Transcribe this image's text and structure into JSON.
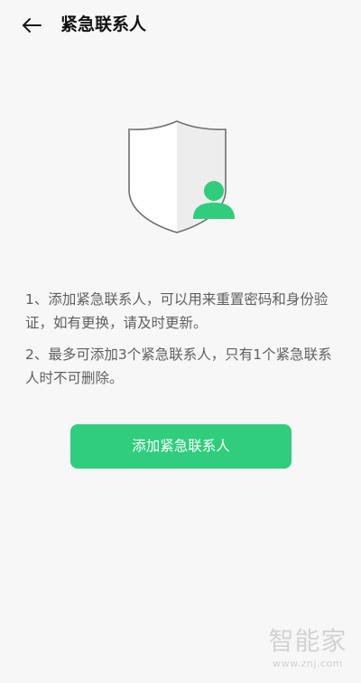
{
  "header": {
    "back_icon": "arrow-left-icon",
    "title": "紧急联系人"
  },
  "illustration": {
    "shield_icon": "shield-icon",
    "contact_icon": "person-icon",
    "accent_color": "#2fcd7c"
  },
  "descriptions": [
    "1、添加紧急联系人，可以用来重置密码和身份验证，如有更换，请及时更新。",
    "2、最多可添加3个紧急联系人，只有1个紧急联系人时不可删除。"
  ],
  "actions": {
    "add_contact_label": "添加紧急联系人",
    "button_color": "#2fcd7c"
  },
  "watermark": {
    "logo_text": "智能家",
    "url": "www.znj.com"
  }
}
